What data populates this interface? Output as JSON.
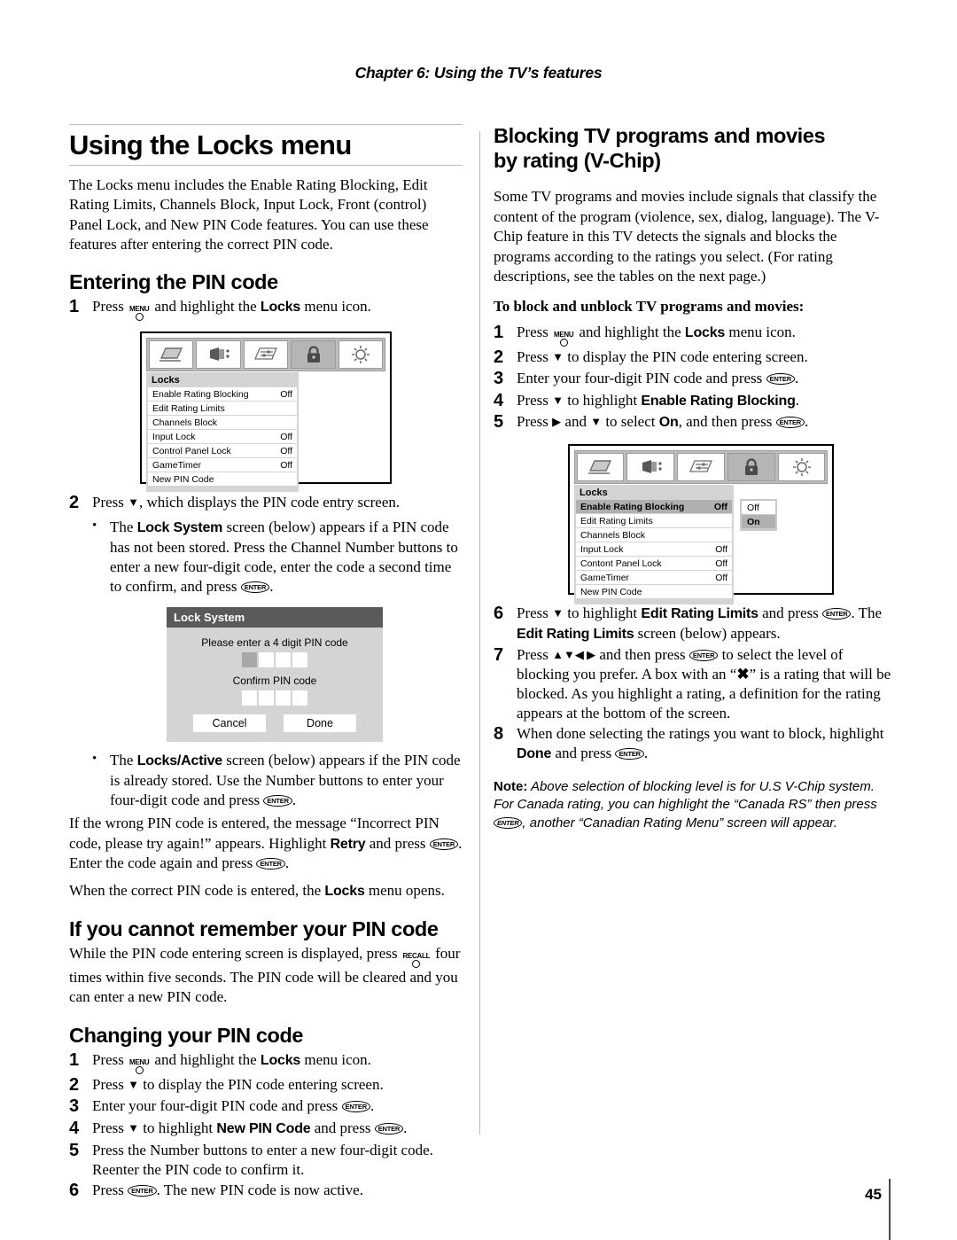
{
  "page": {
    "chapter_header": "Chapter 6: Using the TV’s features",
    "page_number": "45"
  },
  "left": {
    "h1": "Using the Locks menu",
    "intro": "The Locks menu includes the Enable Rating Blocking, Edit Rating Limits, Channels Block, Input Lock, Front (control) Panel Lock, and New PIN Code features. You can use these features after entering the correct PIN code.",
    "entering_pin": {
      "heading": "Entering the PIN code",
      "step1_num": "1",
      "step1_a": "Press",
      "step1_key_menu": "MENU",
      "step1_b": "and highlight the",
      "step1_bold": "Locks",
      "step1_c": "menu icon.",
      "step2_num": "2",
      "step2_a": "Press",
      "step2_arrow": "▼",
      "step2_b": ", which displays the PIN code entry screen.",
      "bullet1_dot": "•",
      "bullet1_a": "The",
      "bullet1_bold": "Lock System",
      "bullet1_b": "screen (below) appears if a PIN code has not been stored. Press the Channel Number buttons to enter a new four-digit code, enter the code a second time to confirm, and press",
      "bullet1_key": "ENTER",
      "bullet1_c": ".",
      "bullet2_dot": "•",
      "bullet2_a": "The",
      "bullet2_bold": "Locks/Active",
      "bullet2_b": "screen (below) appears if the PIN code is already stored. Use the Number buttons to enter your four-digit code and press",
      "bullet2_key": "ENTER",
      "bullet2_c": ".",
      "para_wrong_a": "If the wrong PIN code is entered, the message “Incorrect PIN code, please try again!” appears. Highlight",
      "para_wrong_bold": "Retry",
      "para_wrong_b": "and press",
      "para_wrong_key1": "ENTER",
      "para_wrong_c": ". Enter the code again and press",
      "para_wrong_key2": "ENTER",
      "para_wrong_d": ".",
      "para_correct_a": "When the correct PIN code is entered, the",
      "para_correct_bold": "Locks",
      "para_correct_b": "menu opens."
    },
    "osd": {
      "title": "Locks",
      "icons": [
        "picture-icon",
        "audio-icon",
        "settings-icon",
        "lock-icon",
        "setup-icon"
      ],
      "selected_icon_index": 3,
      "rows": [
        {
          "label": "Enable Rating Blocking",
          "value": "Off",
          "highlight": false
        },
        {
          "label": "Edit Rating Limits",
          "value": "",
          "highlight": false
        },
        {
          "label": "Channels Block",
          "value": "",
          "highlight": false
        },
        {
          "label": "Input Lock",
          "value": "Off",
          "highlight": false
        },
        {
          "label": "Control Panel Lock",
          "value": "Off",
          "highlight": false
        },
        {
          "label": "GameTimer",
          "value": "Off",
          "highlight": false
        },
        {
          "label": "New PIN Code",
          "value": "",
          "highlight": false
        }
      ]
    },
    "dialog": {
      "title": "Lock System",
      "enter_label": "Please enter a 4 digit PIN code",
      "confirm_label": "Confirm PIN code",
      "enter_boxes": [
        true,
        false,
        false,
        false
      ],
      "confirm_boxes": [
        false,
        false,
        false,
        false
      ],
      "cancel_label": "Cancel",
      "done_label": "Done"
    },
    "forgot_pin": {
      "heading": "If you cannot remember your PIN code",
      "text_a": "While the PIN code entering screen is displayed, press",
      "key_recall": "RECALL",
      "text_b": "four times within five seconds. The PIN code will be cleared and you can enter a new PIN code."
    },
    "changing_pin": {
      "heading": "Changing your PIN code",
      "steps": [
        {
          "num": "1",
          "parts": [
            "Press",
            "__MENU__",
            "and highlight the",
            "__B:Locks__",
            "menu icon."
          ]
        },
        {
          "num": "2",
          "parts": [
            "Press",
            "__ARROW:▼__",
            "to display the PIN code entering screen."
          ]
        },
        {
          "num": "3",
          "parts": [
            "Enter your four-digit PIN code and press",
            "__ENTER__",
            "."
          ]
        },
        {
          "num": "4",
          "parts": [
            "Press",
            "__ARROW:▼__",
            "to highlight",
            "__B:New PIN Code__",
            "and press",
            "__ENTER__",
            "."
          ]
        },
        {
          "num": "5",
          "parts": [
            "Press the Number buttons to enter a new four-digit code. Reenter the PIN code to confirm it."
          ]
        },
        {
          "num": "6",
          "parts": [
            "Press",
            "__ENTER__",
            ". The new PIN code is now active."
          ]
        }
      ],
      "s1_a": "Press",
      "s1_b": "and highlight the",
      "s1_bold": "Locks",
      "s1_c": "menu icon.",
      "s2_a": "Press",
      "s2_arrow": "▼",
      "s2_b": "to display the PIN code entering screen.",
      "s3_a": "Enter your four-digit PIN code and press",
      "s3_key": "ENTER",
      "s3_b": ".",
      "s4_a": "Press",
      "s4_arrow": "▼",
      "s4_b": "to highlight",
      "s4_bold": "New PIN Code",
      "s4_c": "and press",
      "s4_key": "ENTER",
      "s4_d": ".",
      "s5_a": "Press the Number buttons to enter a new four-digit code. Reenter the PIN code to confirm it.",
      "s6_a": "Press",
      "s6_key": "ENTER",
      "s6_b": ". The new PIN code is now active.",
      "nums": {
        "n1": "1",
        "n2": "2",
        "n3": "3",
        "n4": "4",
        "n5": "5",
        "n6": "6"
      }
    }
  },
  "right": {
    "h1_line1": "Blocking TV programs and movies",
    "h1_line2": "by rating (V-Chip)",
    "intro": "Some TV programs and movies include signals that classify the content of the program (violence, sex, dialog, language). The V-Chip feature in this TV detects the signals and blocks the programs according to the ratings you select. (For rating descriptions, see the tables on the next page.)",
    "subhead": "To block and unblock TV programs and movies:",
    "steps_top": {
      "n1": "1",
      "n2": "2",
      "n3": "3",
      "n4": "4",
      "n5": "5",
      "s1_a": "Press",
      "s1_menu": "MENU",
      "s1_b": "and highlight the",
      "s1_bold": "Locks",
      "s1_c": "menu icon.",
      "s2_a": "Press",
      "s2_arrow": "▼",
      "s2_b": "to display the PIN code entering screen.",
      "s3_a": "Enter your four-digit PIN code and press",
      "s3_key": "ENTER",
      "s3_b": ".",
      "s4_a": "Press",
      "s4_arrow": "▼",
      "s4_b": "to highlight",
      "s4_bold": "Enable Rating Blocking",
      "s4_c": ".",
      "s5_a": "Press",
      "s5_arrow1": "▶",
      "s5_b": "and",
      "s5_arrow2": "▼",
      "s5_c": "to select",
      "s5_bold": "On",
      "s5_d": ", and then press",
      "s5_key": "ENTER",
      "s5_e": "."
    },
    "osd": {
      "title": "Locks",
      "icons": [
        "picture-icon",
        "audio-icon",
        "settings-icon",
        "lock-icon",
        "setup-icon"
      ],
      "selected_icon_index": 3,
      "rows": [
        {
          "label": "Enable Rating Blocking",
          "value": "Off",
          "highlight": true
        },
        {
          "label": "Edit Rating Limits",
          "value": "",
          "highlight": false
        },
        {
          "label": "Channels Block",
          "value": "",
          "highlight": false
        },
        {
          "label": "Input Lock",
          "value": "Off",
          "highlight": false
        },
        {
          "label": "Contont Panel Lock",
          "value": "Off",
          "highlight": false
        },
        {
          "label": "GameTimer",
          "value": "Off",
          "highlight": false
        },
        {
          "label": "New PIN Code",
          "value": "",
          "highlight": false
        }
      ],
      "popup": {
        "options": [
          {
            "label": "Off",
            "selected": false
          },
          {
            "label": "On",
            "selected": true
          }
        ]
      }
    },
    "steps_bottom": {
      "n6": "6",
      "n7": "7",
      "n8": "8",
      "s6_a": "Press",
      "s6_arrow": "▼",
      "s6_b": "to highlight",
      "s6_bold1": "Edit Rating Limits",
      "s6_c": "and press",
      "s6_key": "ENTER",
      "s6_d": ". The",
      "s6_bold2": "Edit Rating Limits",
      "s6_e": "screen (below) appears.",
      "s7_a": "Press",
      "s7_arrows": "▲▼◀ ▶",
      "s7_b": "and then press",
      "s7_key": "ENTER",
      "s7_c": "to select the level of blocking you prefer. A box with an “",
      "s7_x": "✖",
      "s7_d": "” is a rating that will be blocked. As you highlight a rating, a definition for the rating appears at the bottom of the screen.",
      "s8_a": "When done selecting the ratings you want to block, highlight",
      "s8_bold": "Done",
      "s8_b": "and press",
      "s8_key": "ENTER",
      "s8_c": "."
    },
    "note": {
      "label": "Note:",
      "text_a": "Above selection of blocking level is for U.S V-Chip system. For Canada rating, you can highlight the “Canada RS” then press",
      "key": "ENTER",
      "text_b": ", another “Canadian Rating Menu” screen will appear."
    }
  }
}
